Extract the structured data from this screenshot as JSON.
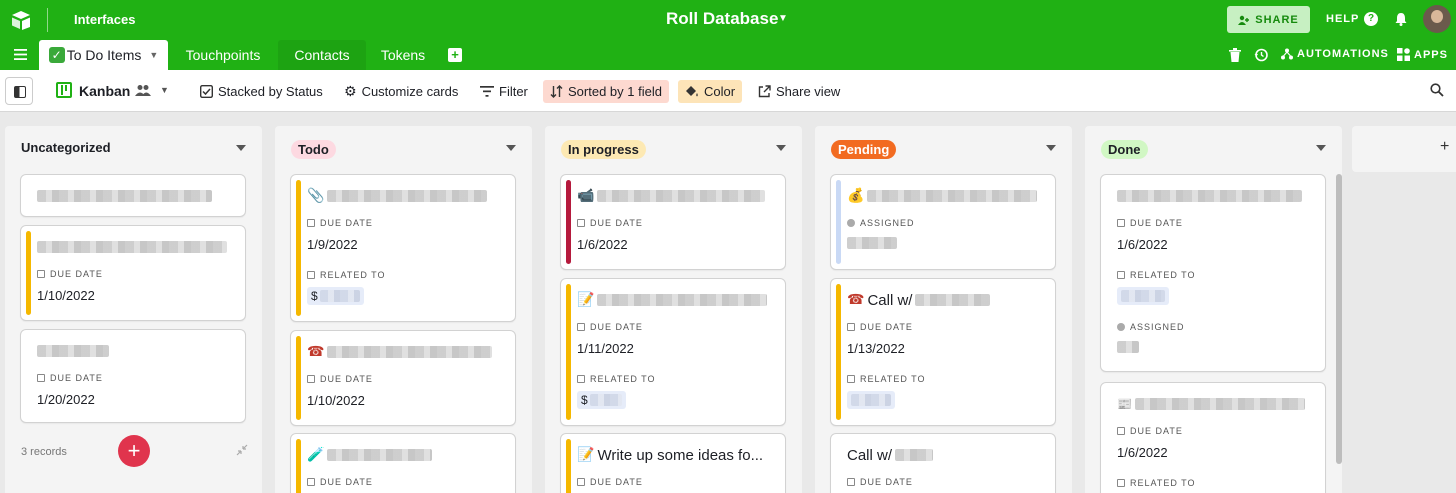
{
  "header": {
    "interfaces_label": "Interfaces",
    "database_title": "Roll Database",
    "share_label": "SHARE",
    "help_label": "HELP"
  },
  "tabs": {
    "active": "To Do Items",
    "others": [
      "Touchpoints",
      "Contacts",
      "Tokens"
    ],
    "automations_label": "AUTOMATIONS",
    "apps_label": "APPS"
  },
  "toolbar": {
    "view_name": "Kanban",
    "stacked_label": "Stacked by Status",
    "customize_label": "Customize cards",
    "filter_label": "Filter",
    "sorted_label": "Sorted by 1 field",
    "color_label": "Color",
    "share_view_label": "Share view"
  },
  "colors": {
    "brand": "#20b114",
    "accent_yellow": "#f5b800",
    "accent_red": "#b51a3d",
    "accent_blue": "#c9d9f5"
  },
  "columns": [
    {
      "name": "Uncategorized",
      "footer": "3 records",
      "cards": [
        {
          "fields": []
        },
        {
          "fields": [
            {
              "label": "DUE DATE",
              "value": "1/10/2022"
            }
          ]
        },
        {
          "fields": [
            {
              "label": "DUE DATE",
              "value": "1/20/2022"
            }
          ]
        }
      ]
    },
    {
      "name": "Todo",
      "cards": [
        {
          "fields": [
            {
              "label": "DUE DATE",
              "value": "1/9/2022"
            },
            {
              "label": "RELATED TO",
              "value": "$"
            }
          ]
        },
        {
          "fields": [
            {
              "label": "DUE DATE",
              "value": "1/10/2022"
            }
          ]
        },
        {
          "fields": [
            {
              "label": "DUE DATE",
              "value": ""
            }
          ]
        }
      ]
    },
    {
      "name": "In progress",
      "cards": [
        {
          "fields": [
            {
              "label": "DUE DATE",
              "value": "1/6/2022"
            }
          ]
        },
        {
          "fields": [
            {
              "label": "DUE DATE",
              "value": "1/11/2022"
            },
            {
              "label": "RELATED TO",
              "value": "$"
            }
          ]
        },
        {
          "title": "Write up some ideas fo...",
          "fields": [
            {
              "label": "DUE DATE",
              "value": ""
            }
          ]
        }
      ]
    },
    {
      "name": "Pending",
      "cards": [
        {
          "fields": [
            {
              "label": "ASSIGNED",
              "value": ""
            }
          ]
        },
        {
          "title": "Call w/",
          "fields": [
            {
              "label": "DUE DATE",
              "value": "1/13/2022"
            },
            {
              "label": "RELATED TO",
              "value": ""
            }
          ]
        },
        {
          "title": "Call w/",
          "fields": [
            {
              "label": "DUE DATE",
              "value": ""
            }
          ]
        }
      ]
    },
    {
      "name": "Done",
      "cards": [
        {
          "fields": [
            {
              "label": "DUE DATE",
              "value": "1/6/2022"
            },
            {
              "label": "RELATED TO",
              "value": ""
            },
            {
              "label": "ASSIGNED",
              "value": ""
            }
          ]
        },
        {
          "fields": [
            {
              "label": "DUE DATE",
              "value": "1/6/2022"
            },
            {
              "label": "RELATED TO",
              "value": ""
            }
          ]
        }
      ]
    }
  ]
}
